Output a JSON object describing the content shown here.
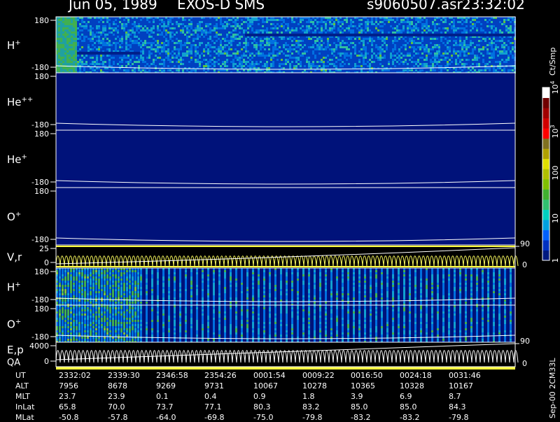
{
  "header": {
    "date": "Jun 05, 1989",
    "instrument": "EXOS-D SMS",
    "file": "s9060507.asr",
    "time": "23:32:02"
  },
  "colorbar": {
    "unit": "Ct/Smp",
    "ticks": [
      "1",
      "10",
      "100",
      "10",
      "10"
    ],
    "tick_exponents": [
      "",
      "",
      "",
      "3",
      "4"
    ],
    "colors": [
      "#001a80",
      "#0030c0",
      "#0060ff",
      "#00a0e0",
      "#00d0c0",
      "#30c070",
      "#40b030",
      "#80c000",
      "#b0c000",
      "#e0e000",
      "#b0a000",
      "#807020",
      "#ff0000",
      "#d00000",
      "#a00000",
      "#700000",
      "#ffffff"
    ]
  },
  "panels": [
    {
      "label": "H",
      "sup": "+",
      "ymax": "180",
      "ymin": "-180",
      "type": "spectrogram",
      "activity": "high"
    },
    {
      "label": "He",
      "sup": "++",
      "ymax": "180",
      "ymin": "-180",
      "type": "spectrogram",
      "activity": "none"
    },
    {
      "label": "He",
      "sup": "+",
      "ymax": "180",
      "ymin": "-180",
      "type": "spectrogram",
      "activity": "none"
    },
    {
      "label": "O",
      "sup": "+",
      "ymax": "180",
      "ymin": "-180",
      "type": "spectrogram",
      "activity": "none"
    },
    {
      "label": "V,r",
      "sup": "",
      "ymax": "25",
      "ymin": "0",
      "right_max": "90",
      "right_min": "0",
      "type": "line"
    },
    {
      "label": "H",
      "sup": "+",
      "ymax": "180",
      "ymin": "-180",
      "type": "spectrogram",
      "activity": "striped"
    },
    {
      "label": "O",
      "sup": "+",
      "ymax": "180",
      "ymin": "-180",
      "type": "spectrogram",
      "activity": "striped"
    },
    {
      "label": "E,p",
      "label2": "QA",
      "sup": "",
      "ymax": "4000",
      "ymin": "0",
      "right_max": "90",
      "right_min": "0",
      "type": "line"
    }
  ],
  "footer": {
    "row_labels": [
      "UT",
      "ALT",
      "MLT",
      "InLat",
      "MLat"
    ],
    "columns": [
      {
        "UT": "2332:02",
        "ALT": "7956",
        "MLT": "23.7",
        "InLat": "65.8",
        "MLat": "-50.8"
      },
      {
        "UT": "2339:30",
        "ALT": "8678",
        "MLT": "23.9",
        "InLat": "70.0",
        "MLat": "-57.8"
      },
      {
        "UT": "2346:58",
        "ALT": "9269",
        "MLT": "0.1",
        "InLat": "73.7",
        "MLat": "-64.0"
      },
      {
        "UT": "2354:26",
        "ALT": "9731",
        "MLT": "0.4",
        "InLat": "77.1",
        "MLat": "-69.8"
      },
      {
        "UT": "0001:54",
        "ALT": "10067",
        "MLT": "0.9",
        "InLat": "80.3",
        "MLat": "-75.0"
      },
      {
        "UT": "0009:22",
        "ALT": "10278",
        "MLT": "1.8",
        "InLat": "83.2",
        "MLat": "-79.8"
      },
      {
        "UT": "0016:50",
        "ALT": "10365",
        "MLT": "3.9",
        "InLat": "85.0",
        "MLat": "-83.2"
      },
      {
        "UT": "0024:18",
        "ALT": "10328",
        "MLT": "6.9",
        "InLat": "85.0",
        "MLat": "-83.2"
      },
      {
        "UT": "0031:46",
        "ALT": "10167",
        "MLT": "8.7",
        "InLat": "84.3",
        "MLat": "-79.8"
      }
    ],
    "side_note": "Sep-00 2CM33L"
  },
  "chart_data": {
    "type": "heatmap",
    "title": "Jun 05, 1989   EXOS-D SMS",
    "xlabel": "UT",
    "x": [
      "2332:02",
      "2339:30",
      "2346:58",
      "2354:26",
      "0001:54",
      "0009:22",
      "0016:50",
      "0024:18",
      "0031:46"
    ],
    "series": [
      {
        "name": "H+",
        "ylim": [
          -180,
          180
        ]
      },
      {
        "name": "He++",
        "ylim": [
          -180,
          180
        ]
      },
      {
        "name": "He+",
        "ylim": [
          -180,
          180
        ]
      },
      {
        "name": "O+",
        "ylim": [
          -180,
          180
        ]
      },
      {
        "name": "V,r",
        "ylim": [
          0,
          25
        ]
      },
      {
        "name": "H+",
        "ylim": [
          -180,
          180
        ]
      },
      {
        "name": "O+",
        "ylim": [
          -180,
          180
        ]
      },
      {
        "name": "E,p",
        "ylim": [
          0,
          4000
        ]
      }
    ],
    "colorbar_label": "Ct/Smp",
    "colorbar_range": [
      "1",
      "10^4"
    ]
  }
}
